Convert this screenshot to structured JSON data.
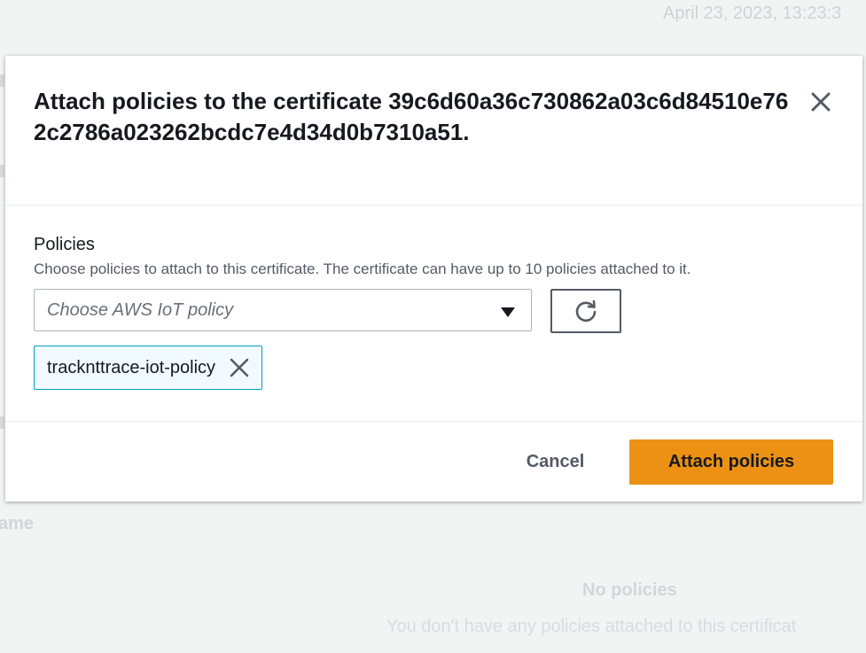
{
  "background": {
    "timestamp": "April 23, 2023, 13:23:3",
    "column_header": "ame",
    "empty_title": "No policies",
    "empty_description": "You don't have any policies attached to this certificat"
  },
  "modal": {
    "title": "Attach policies to the certificate 39c6d60a36c730862a03c6d84510e762c2786a023262bcdc7e4d34d0b7310a51.",
    "close_icon": "close-icon",
    "policies": {
      "label": "Policies",
      "description": "Choose policies to attach to this certificate. The certificate can have up to 10 policies attached to it.",
      "select_placeholder": "Choose AWS IoT policy",
      "refresh_icon": "refresh-icon",
      "selected_tokens": [
        {
          "label": "tracknttrace-iot-policy"
        }
      ]
    },
    "footer": {
      "cancel_label": "Cancel",
      "attach_label": "Attach policies"
    }
  },
  "colors": {
    "primary_button": "#ec9113",
    "token_border": "#00a1c9",
    "token_background": "#f1faff"
  }
}
